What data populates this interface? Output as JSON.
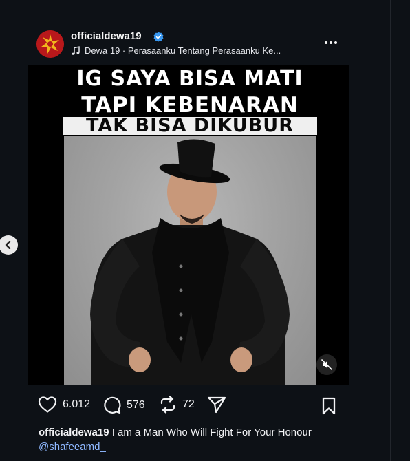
{
  "post": {
    "username": "officialdewa19",
    "verified": true,
    "music": "Dewa 19 · Perasaanku Tentang Perasaanku Ke...",
    "headline": [
      "IG SAYA BISA MATI",
      "TAPI KEBENARAN",
      "TAK BISA DIKUBUR"
    ]
  },
  "actions": {
    "likes": "6.012",
    "comments": "576",
    "reposts": "72"
  },
  "caption": {
    "username": "officialdewa19",
    "text": " I am a Man Who Will Fight For Your Honour ",
    "mention": "@shafeeamd_"
  },
  "colors": {
    "background": "#0d1116",
    "verified": "#3897f0",
    "mention": "#8fb8ff"
  },
  "icons": {
    "avatar": "red-star-logo",
    "verified": "verified-badge-icon",
    "music": "music-note-icon",
    "more": "more-dots-icon",
    "mute": "speaker-muted-icon",
    "prev": "chevron-left-icon",
    "like": "heart-icon",
    "comment": "comment-icon",
    "repost": "repost-icon",
    "share": "share-icon",
    "save": "bookmark-icon"
  }
}
